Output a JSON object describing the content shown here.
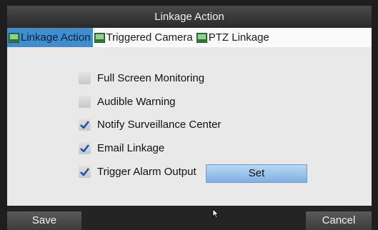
{
  "dialog": {
    "title": "Linkage Action",
    "tabs": [
      {
        "label": "Linkage Action",
        "icon": "camera-tab-icon",
        "active": true
      },
      {
        "label": "Triggered Camera",
        "icon": "camera-tab-icon",
        "active": false
      },
      {
        "label": "PTZ Linkage",
        "icon": "camera-tab-icon",
        "active": false
      }
    ],
    "options": [
      {
        "label": "Full Screen Monitoring",
        "checked": false
      },
      {
        "label": "Audible Warning",
        "checked": false
      },
      {
        "label": "Notify Surveillance Center",
        "checked": true
      },
      {
        "label": "Email Linkage",
        "checked": true
      },
      {
        "label": "Trigger Alarm Output",
        "checked": true
      }
    ],
    "set_label": "Set",
    "save_label": "Save",
    "cancel_label": "Cancel"
  },
  "colors": {
    "accent": "#3c8fd0",
    "check": "#1a56a8"
  }
}
